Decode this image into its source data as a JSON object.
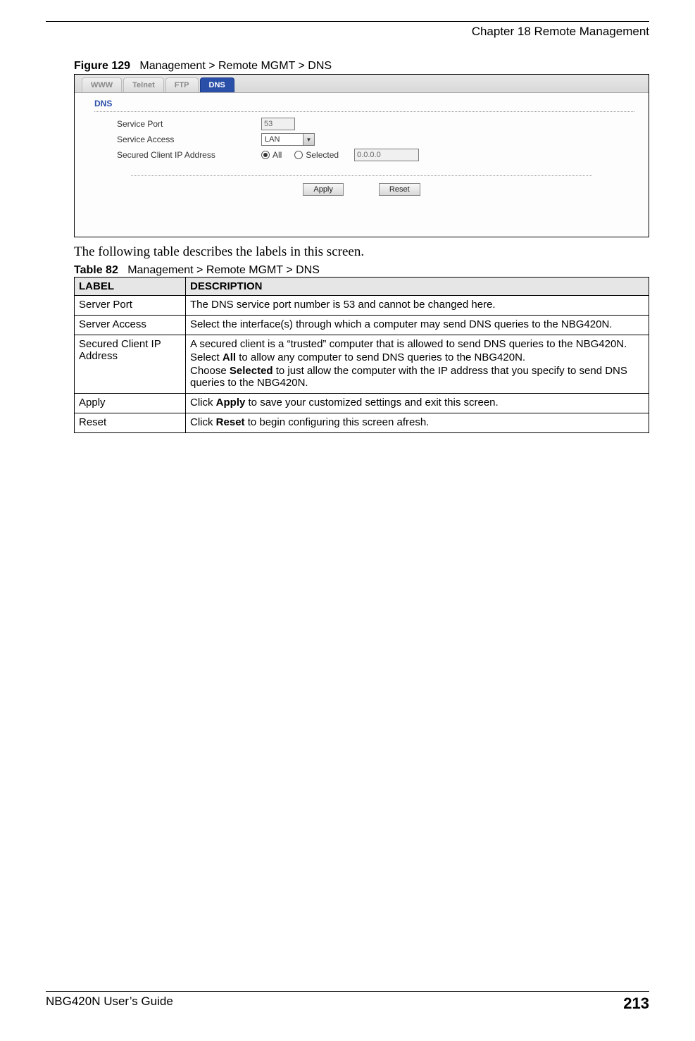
{
  "header": {
    "chapter": "Chapter 18 Remote Management"
  },
  "figure": {
    "label": "Figure 129",
    "title": "Management > Remote MGMT > DNS"
  },
  "screenshot": {
    "tabs": [
      "WWW",
      "Telnet",
      "FTP",
      "DNS"
    ],
    "active_tab_index": 3,
    "panel_title": "DNS",
    "rows": {
      "service_port": {
        "label": "Service Port",
        "value": "53"
      },
      "service_access": {
        "label": "Service Access",
        "value": "LAN"
      },
      "secured_ip": {
        "label": "Secured Client IP Address",
        "option_all": "All",
        "option_selected": "Selected",
        "ip_value": "0.0.0.0"
      }
    },
    "buttons": {
      "apply": "Apply",
      "reset": "Reset"
    }
  },
  "body_text": "The following table describes the labels in this screen.",
  "table": {
    "label": "Table 82",
    "title": "Management > Remote MGMT > DNS",
    "headers": {
      "col1": "LABEL",
      "col2": "DESCRIPTION"
    },
    "rows": [
      {
        "label": "Server Port",
        "desc": [
          {
            "pre": "",
            "bold": "",
            "post": "The DNS service port number is 53 and cannot be changed here."
          }
        ]
      },
      {
        "label": "Server Access",
        "desc": [
          {
            "pre": "",
            "bold": "",
            "post": "Select the interface(s) through which a computer may send DNS queries to the NBG420N."
          }
        ]
      },
      {
        "label": "Secured Client IP Address",
        "desc": [
          {
            "pre": "",
            "bold": "",
            "post": "A secured client is a “trusted” computer that is allowed to send DNS queries to the NBG420N."
          },
          {
            "pre": "Select ",
            "bold": "All",
            "post": " to allow any computer to send DNS queries to the NBG420N."
          },
          {
            "pre": "Choose ",
            "bold": "Selected",
            "post": " to just allow the computer with the IP address that you specify to send DNS queries to the NBG420N."
          }
        ]
      },
      {
        "label": "Apply",
        "desc": [
          {
            "pre": "Click ",
            "bold": "Apply",
            "post": " to save your customized settings and exit this screen."
          }
        ]
      },
      {
        "label": "Reset",
        "desc": [
          {
            "pre": "Click ",
            "bold": "Reset",
            "post": " to begin configuring this screen afresh."
          }
        ]
      }
    ]
  },
  "footer": {
    "guide": "NBG420N User’s Guide",
    "page": "213"
  }
}
